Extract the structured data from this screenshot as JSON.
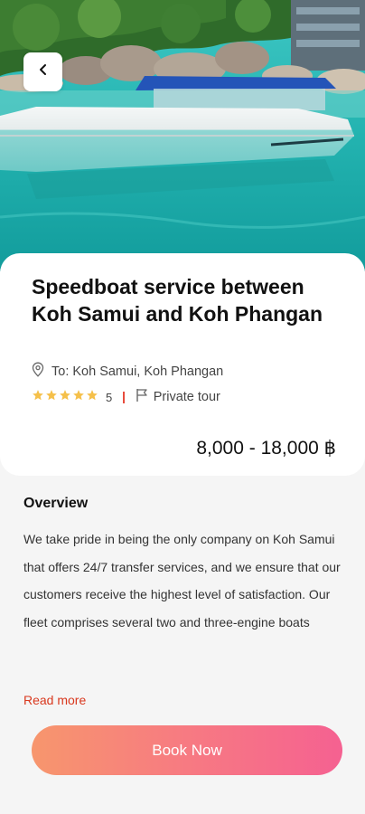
{
  "tour": {
    "title": "Speedboat service between Koh Samui and Koh Phangan",
    "location": "To: Koh Samui, Koh Phangan",
    "rating": "5",
    "stars": 5,
    "type": "Private tour",
    "price": "8,000 - 18,000 ฿"
  },
  "overview": {
    "heading": "Overview",
    "text": "We take pride in being the only company on Koh Samui that offers 24/7 transfer services, and we ensure that our customers receive the highest level of satisfaction. Our fleet comprises several two and three-engine boats",
    "read_more": "Read more"
  },
  "actions": {
    "book_label": "Book Now"
  },
  "icons": {
    "back": "chevron-left-icon",
    "location": "location-pin-icon",
    "star": "star-icon",
    "tour_type": "flag-icon"
  },
  "colors": {
    "star": "#f5c04a",
    "accent": "#d9381e",
    "button_gradient_start": "#f7966d",
    "button_gradient_end": "#f56191"
  }
}
